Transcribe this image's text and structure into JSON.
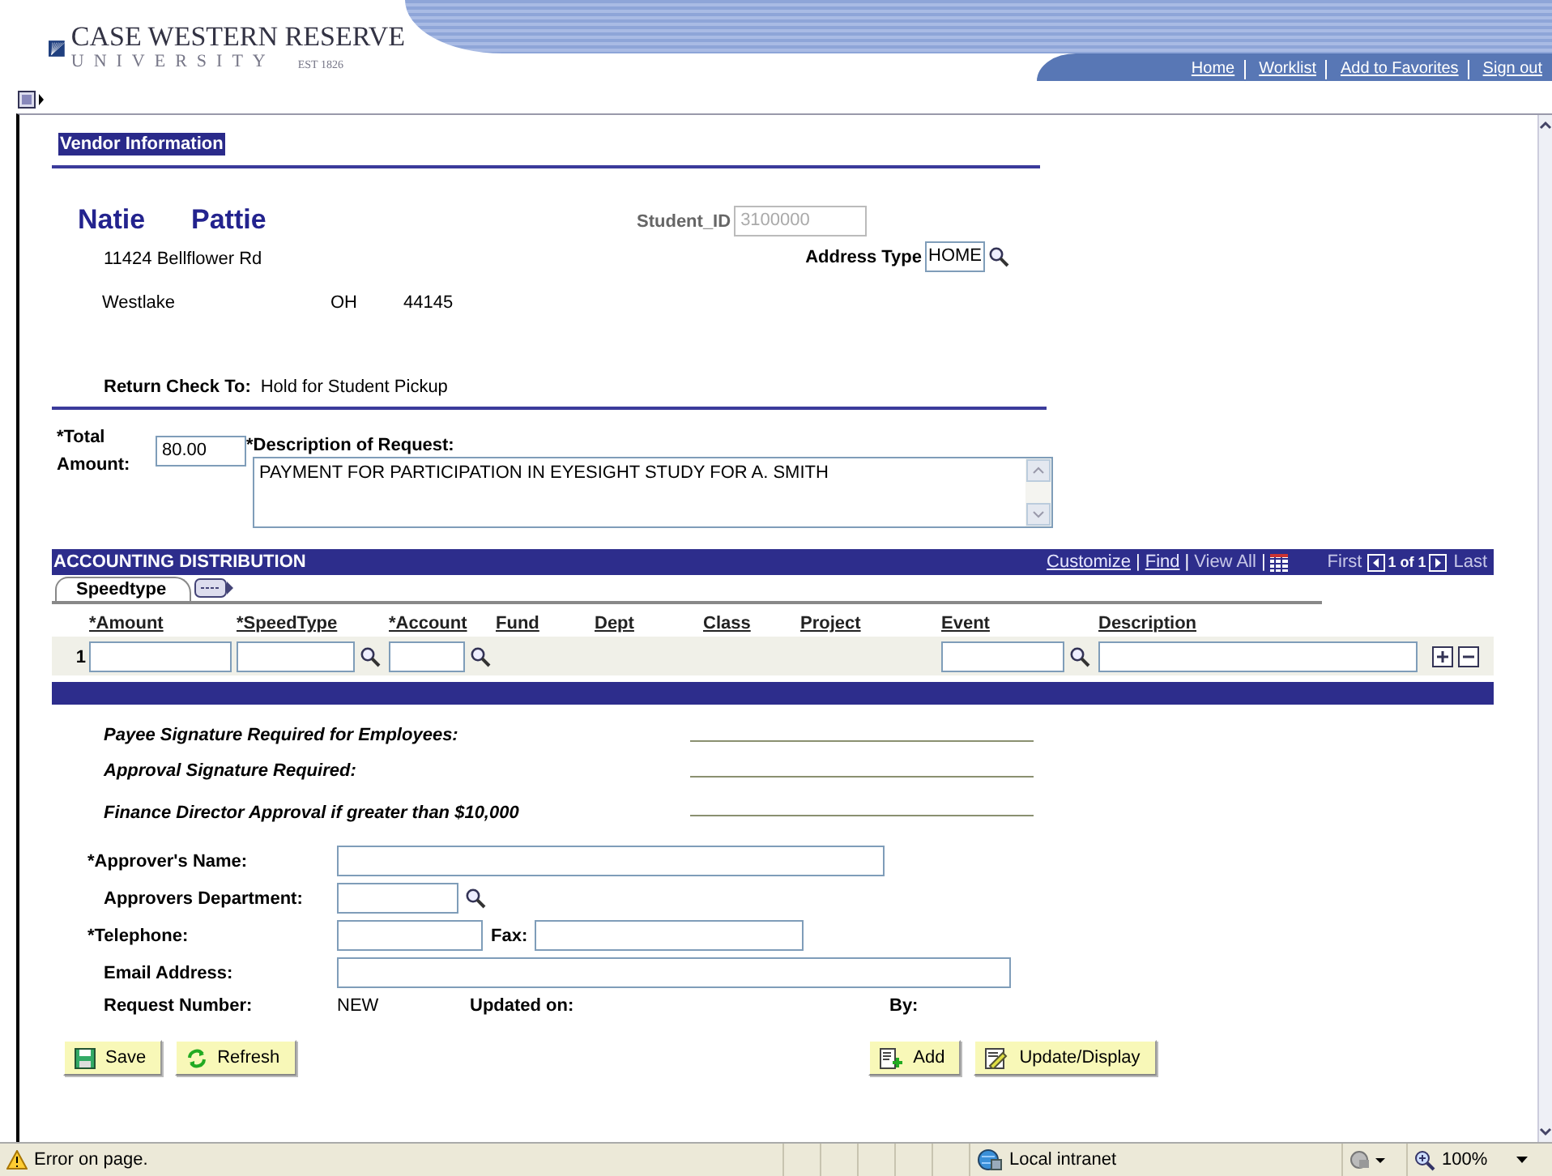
{
  "header": {
    "logo": {
      "name": "CASE WESTERN RESERVE",
      "subtitle": "UNIVERSITY",
      "established": "EST 1826"
    },
    "nav_links": [
      "Home",
      "Worklist",
      "Add to Favorites",
      "Sign out"
    ]
  },
  "vendor": {
    "heading": "Vendor Information",
    "first_name": "Natie",
    "last_name": "Pattie",
    "student_id": {
      "label": "Student_ID",
      "value": "3100000",
      "disabled": true
    },
    "address_type": {
      "label": "Address Type",
      "value": "HOME"
    },
    "address": {
      "street": "11424 Bellflower Rd",
      "city": "Westlake",
      "state": "OH",
      "zip": "44145"
    },
    "return_check": {
      "label": "Return Check To:",
      "value": "Hold for Student Pickup"
    }
  },
  "request": {
    "total_label": "*Total Amount:",
    "total_value": "80.00",
    "description_label": "*Description of Request:",
    "description_value": "PAYMENT FOR PARTICIPATION IN EYESIGHT STUDY FOR A. SMITH"
  },
  "accounting": {
    "title": "ACCOUNTING DISTRIBUTION",
    "separator": "|",
    "links": [
      {
        "label": "Customize",
        "kind": "link"
      },
      {
        "label": "Find",
        "kind": "link"
      },
      {
        "label": "View All",
        "kind": "disabled"
      }
    ],
    "first": "First",
    "count": "1 of 1",
    "last": "Last",
    "tabs": [
      {
        "label": "Speedtype",
        "selected": true
      }
    ],
    "columns": [
      {
        "label": "*Amount",
        "kind": "input"
      },
      {
        "label": "*SpeedType",
        "kind": "lookup"
      },
      {
        "label": "*Account",
        "kind": "lookup"
      },
      {
        "label": "Fund",
        "kind": "none"
      },
      {
        "label": "Dept",
        "kind": "none"
      },
      {
        "label": "Class",
        "kind": "none"
      },
      {
        "label": "Project",
        "kind": "none"
      },
      {
        "label": "Event",
        "kind": "lookup"
      },
      {
        "label": "Description",
        "kind": "input"
      }
    ],
    "rows": [
      {
        "number": "1"
      }
    ]
  },
  "signatures": [
    "Payee Signature Required for Employees:",
    "Approval Signature Required:",
    "Finance Director Approval if greater than $10,000"
  ],
  "approver_fields": [
    {
      "label": "*Approver's Name:",
      "required": true,
      "kind": "text"
    },
    {
      "label": "Approvers Department:",
      "required": false,
      "kind": "lookup"
    },
    {
      "label": "*Telephone:",
      "required": true,
      "kind": "pair",
      "extra_label": "Fax:"
    },
    {
      "label": "Email Address:",
      "required": false,
      "kind": "text"
    }
  ],
  "request_info": {
    "number_label": "Request Number:",
    "number_value": "NEW",
    "updated_label": "Updated on:",
    "by_label": "By:"
  },
  "buttons_left": [
    {
      "label": "Save",
      "kind": "save"
    },
    {
      "label": "Refresh",
      "kind": "refresh"
    }
  ],
  "buttons_right": [
    {
      "label": "Add",
      "kind": "add"
    },
    {
      "label": "Update/Display",
      "kind": "edit"
    }
  ],
  "status_bar": {
    "message": "Error on page.",
    "zone": "Local intranet",
    "zoom": "100%"
  }
}
